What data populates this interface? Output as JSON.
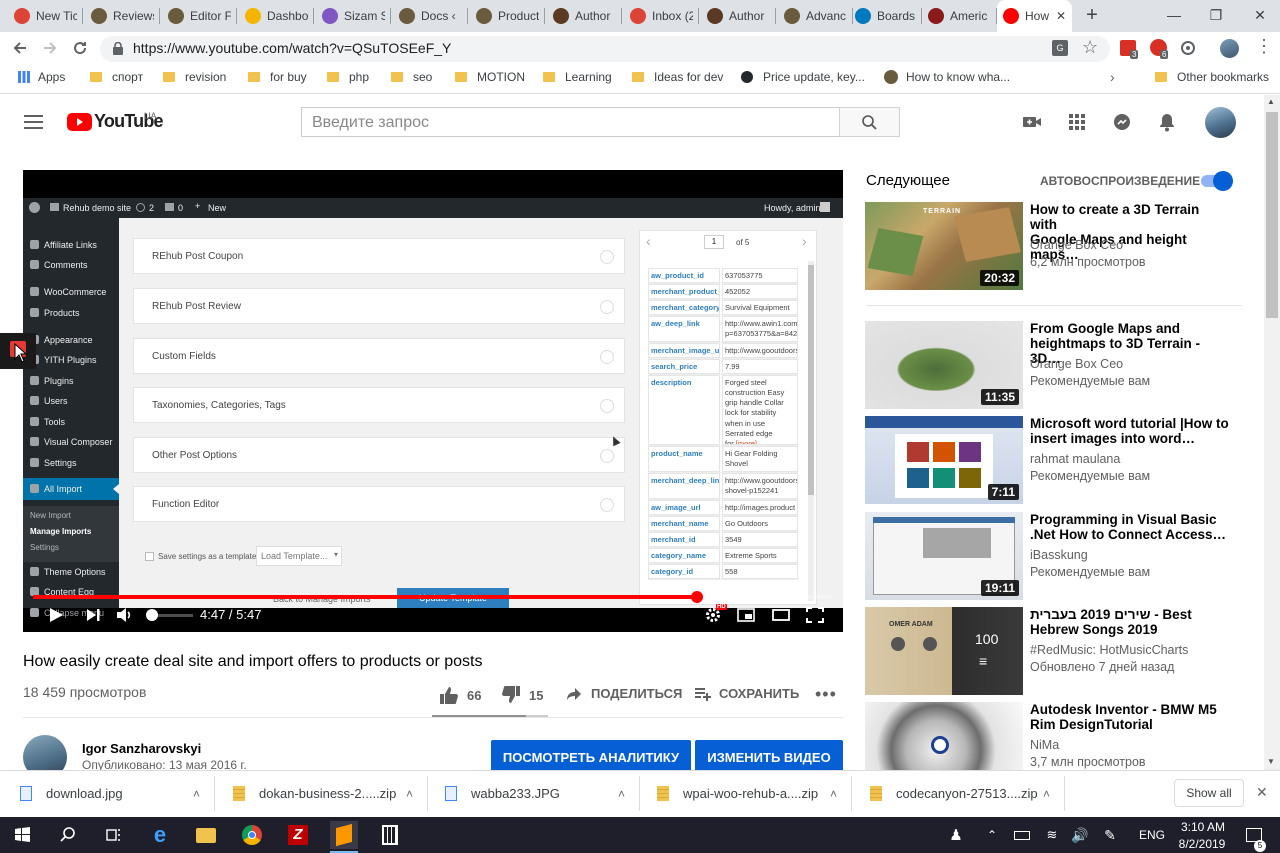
{
  "browser": {
    "tabs": [
      {
        "label": "New Tic",
        "icon": "gmail-icon",
        "color": "#db4437"
      },
      {
        "label": "Reviews",
        "icon": "site-icon",
        "color": "#6b5b3e"
      },
      {
        "label": "Editor F",
        "icon": "site-icon",
        "color": "#6b5b3e"
      },
      {
        "label": "Dashbo",
        "icon": "dashboard-icon",
        "color": "#f4b400"
      },
      {
        "label": "Sizam S",
        "icon": "user-icon",
        "color": "#7e57c2"
      },
      {
        "label": "Docs ‹",
        "icon": "site-icon",
        "color": "#6b5b3e"
      },
      {
        "label": "Product",
        "icon": "site-icon",
        "color": "#6b5b3e"
      },
      {
        "label": "Author",
        "icon": "envato-icon",
        "color": "#5a3a22"
      },
      {
        "label": "Inbox (2",
        "icon": "gmail-icon",
        "color": "#db4437"
      },
      {
        "label": "Author",
        "icon": "envato-icon",
        "color": "#5a3a22"
      },
      {
        "label": "Advanc",
        "icon": "site-icon",
        "color": "#6b5b3e"
      },
      {
        "label": "Boards",
        "icon": "trello-icon",
        "color": "#0079bf"
      },
      {
        "label": "Americ",
        "icon": "site-icon",
        "color": "#8b1a1a"
      },
      {
        "label": "How",
        "icon": "youtube-icon",
        "color": "#ff0000",
        "active": true
      }
    ],
    "url": "https://www.youtube.com/watch?v=QSuTOSEeF_Y",
    "extension_badges": [
      "3",
      "6"
    ],
    "bookmarks": [
      {
        "label": "Apps",
        "type": "apps"
      },
      {
        "label": "спорт",
        "type": "folder"
      },
      {
        "label": "revision",
        "type": "folder"
      },
      {
        "label": "for buy",
        "type": "folder"
      },
      {
        "label": "php",
        "type": "folder"
      },
      {
        "label": "seo",
        "type": "folder"
      },
      {
        "label": "MOTION",
        "type": "folder"
      },
      {
        "label": "Learning",
        "type": "folder"
      },
      {
        "label": "Ideas for dev",
        "type": "folder"
      },
      {
        "label": "Price update, key...",
        "type": "github"
      },
      {
        "label": "How to know wha...",
        "type": "site"
      }
    ],
    "other_bookmarks": "Other bookmarks"
  },
  "youtube": {
    "logo_text": "YouTube",
    "region": "UA",
    "search_placeholder": "Введите запрос"
  },
  "player": {
    "time": "4:47 / 5:47",
    "progress": 0.83,
    "volume": 0.1,
    "hd_badge": "HD",
    "wp": {
      "site_name": "Rehub demo site",
      "updates": "2",
      "comments": "0",
      "new_label": "New",
      "howdy": "Howdy, admin",
      "menu": [
        "Affiliate Links",
        "Comments",
        "WooCommerce",
        "Products",
        "Appearance",
        "YITH Plugins",
        "Plugins",
        "Users",
        "Tools",
        "Visual Composer",
        "Settings",
        "All Import"
      ],
      "submenu": [
        "New Import",
        "Manage Imports",
        "Settings"
      ],
      "menu_bottom": [
        "Theme Options",
        "Content Egg",
        "Collapse menu"
      ],
      "boxes": [
        "REhub Post Coupon",
        "REhub Post Review",
        "Custom Fields",
        "Taxonomies, Categories, Tags",
        "Other Post Options",
        "Function Editor"
      ],
      "save_template": "Save settings as a template",
      "load_template": "Load Template...",
      "back_btn": "Back to Manage Imports",
      "update_btn": "Update Template",
      "pager_current": "1",
      "pager_total": "of 5",
      "fields": [
        {
          "k": "aw_product_id",
          "v": "637053775"
        },
        {
          "k": "merchant_product_id",
          "v": "452052"
        },
        {
          "k": "merchant_category",
          "v": "Survival Equipment"
        },
        {
          "k": "aw_deep_link",
          "v": "http://www.awin1.com/pclick.php?p=637053775&a=8427"
        },
        {
          "k": "merchant_image_url",
          "v": "http://www.gooutdoors"
        },
        {
          "k": "search_price",
          "v": "7.99"
        },
        {
          "k": "description",
          "v": "Forged steel construction Easy grip handle Collar lock for stability when in use Serrated edge for"
        },
        {
          "k": "product_name",
          "v": "Hi Gear Folding Shovel"
        },
        {
          "k": "merchant_deep_link",
          "v": "http://www.gooutdoors shovel-p152241"
        },
        {
          "k": "aw_image_url",
          "v": "http://images.product"
        },
        {
          "k": "merchant_name",
          "v": "Go Outdoors"
        },
        {
          "k": "merchant_id",
          "v": "3549"
        },
        {
          "k": "category_name",
          "v": "Extreme Sports"
        },
        {
          "k": "category_id",
          "v": "558"
        }
      ],
      "more_label": "[more]"
    }
  },
  "video": {
    "title": "How easily create deal site and import offers to products or posts",
    "views": "18 459 просмотров",
    "likes": "66",
    "dislikes": "15",
    "share": "ПОДЕЛИТЬСЯ",
    "save": "СОХРАНИТЬ",
    "like_ratio": 0.81,
    "channel": "Igor Sanzharovskyi",
    "published": "Опубликовано: 13 мая 2016 г.",
    "analytics_btn": "ПОСМОТРЕТЬ АНАЛИТИКУ",
    "edit_btn": "ИЗМЕНИТЬ ВИДЕО"
  },
  "sidebar": {
    "next_label": "Следующее",
    "autoplay_label": "АВТОВОСПРОИЗВЕДЕНИЕ",
    "thumb_texts": {
      "terrain": "TERRAIN",
      "playlist_count": "100",
      "cassette_label": "OMER ADAM"
    },
    "recommendations": [
      {
        "title": "How to create a 3D Terrain with\nGoogle Maps and height maps…",
        "channel": "Orange Box Ceo",
        "meta": "6,2 млн просмотров",
        "duration": "20:32"
      },
      {
        "title": "From Google Maps and\nheightmaps to 3D Terrain - 3D…",
        "channel": "Orange Box Ceo",
        "meta": "Рекомендуемые вам",
        "duration": "11:35"
      },
      {
        "title": "Microsoft word tutorial |How to\ninsert images into word…",
        "channel": "rahmat maulana",
        "meta": "Рекомендуемые вам",
        "duration": "7:11"
      },
      {
        "title": "Programming in Visual Basic\n.Net How to Connect Access…",
        "channel": "iBasskung",
        "meta": "Рекомендуемые вам",
        "duration": "19:11"
      },
      {
        "title": "שירים 2019 בעברית - Best\nHebrew Songs 2019",
        "channel": "#RedMusic: HotMusicCharts",
        "meta": "Обновлено 7 дней назад",
        "duration": ""
      },
      {
        "title": "Autodesk Inventor - BMW M5\nRim DesignTutorial",
        "channel": "NiMa",
        "meta": "3,7 млн просмотров",
        "duration": ""
      }
    ]
  },
  "downloads": {
    "items": [
      "download.jpg",
      "dokan-business-2.....zip",
      "wabba233.JPG",
      "wpai-woo-rehub-a....zip",
      "codecanyon-27513....zip"
    ],
    "show_all": "Show all"
  },
  "taskbar": {
    "lang": "ENG",
    "time": "3:10 AM",
    "date": "8/2/2019",
    "notifications": "5"
  }
}
